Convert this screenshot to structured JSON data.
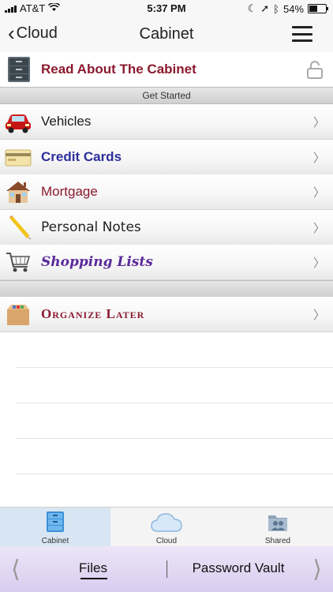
{
  "status": {
    "carrier": "AT&T",
    "time": "5:37 PM",
    "battery": "54%",
    "battery_level": 0.54
  },
  "nav": {
    "back_label": "Cloud",
    "title": "Cabinet"
  },
  "read_about": {
    "label": "Read About The Cabinet",
    "icon": "file-cabinet-icon"
  },
  "sections": {
    "get_started": "Get Started"
  },
  "items": [
    {
      "label": "Vehicles",
      "color": "#1a1a1a",
      "icon": "car-icon"
    },
    {
      "label": "Credit Cards",
      "color": "#2b2f9a",
      "icon": "credit-card-icon"
    },
    {
      "label": "Mortgage",
      "color": "#8b1a2e",
      "icon": "house-icon"
    },
    {
      "label": "Personal Notes",
      "color": "#222222",
      "icon": "pencil-icon"
    },
    {
      "label": "Shopping Lists",
      "color": "#5a2a9a",
      "icon": "shopping-cart-icon"
    }
  ],
  "organize": {
    "label": "Organize Later",
    "color": "#8b1a2e",
    "icon": "box-icon"
  },
  "tabs": [
    {
      "label": "Cabinet",
      "active": true
    },
    {
      "label": "Cloud",
      "active": false
    },
    {
      "label": "Shared",
      "active": false
    }
  ],
  "bottom": {
    "files": "Files",
    "password_vault": "Password Vault"
  }
}
